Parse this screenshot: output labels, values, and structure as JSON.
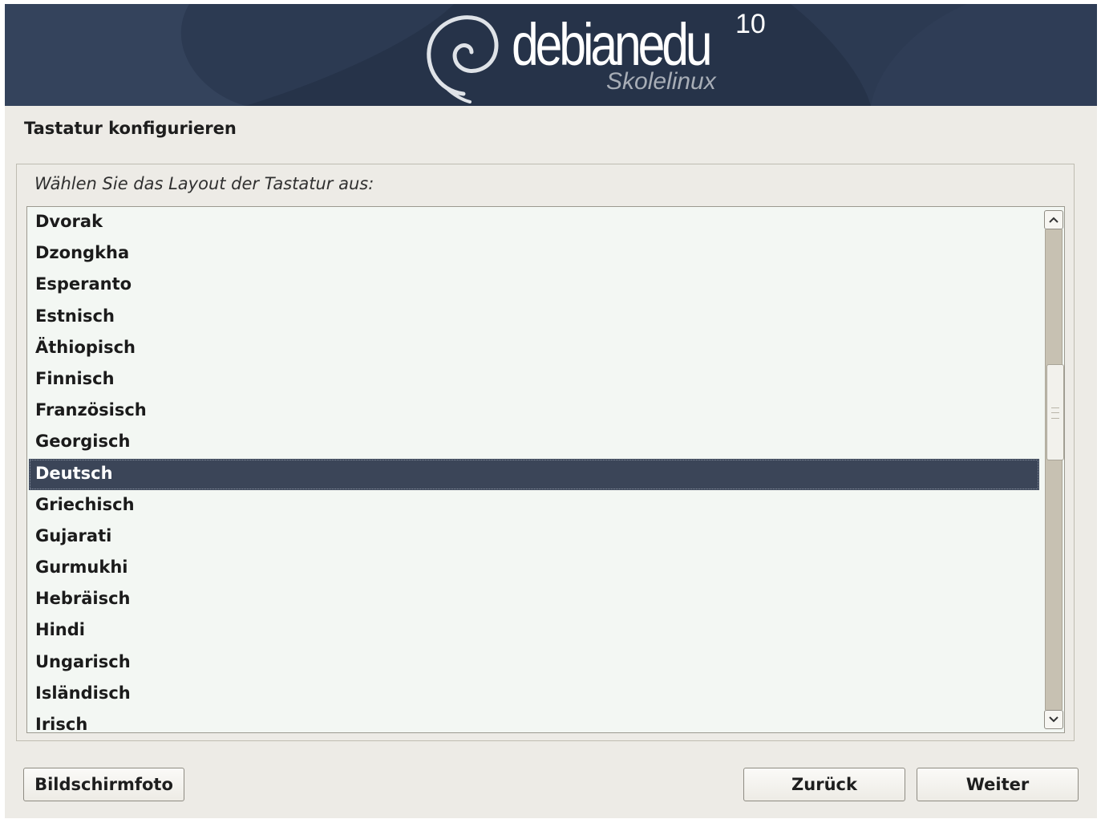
{
  "banner": {
    "logo_text": "debianedu",
    "logo_version": "10",
    "logo_subtitle": "Skolelinux"
  },
  "page_title": "Tastatur konfigurieren",
  "prompt": "Wählen Sie das Layout der Tastatur aus:",
  "list": {
    "items": [
      "Dvorak",
      "Dzongkha",
      "Esperanto",
      "Estnisch",
      "Äthiopisch",
      "Finnisch",
      "Französisch",
      "Georgisch",
      "Deutsch",
      "Griechisch",
      "Gujarati",
      "Gurmukhi",
      "Hebräisch",
      "Hindi",
      "Ungarisch",
      "Isländisch",
      "Irisch"
    ],
    "selected_index": 8
  },
  "scrollbar": {
    "position_fraction": 0.35
  },
  "buttons": {
    "screenshot": "Bildschirmfoto",
    "back": "Zurück",
    "continue": "Weiter"
  },
  "colors": {
    "banner": "#2c3a52",
    "selection": "#3b4558",
    "list_background": "#f3f7f3"
  },
  "icons": {
    "scroll_up": "chevron-up-icon",
    "scroll_down": "chevron-down-icon",
    "logo": "debian-swirl-icon"
  }
}
